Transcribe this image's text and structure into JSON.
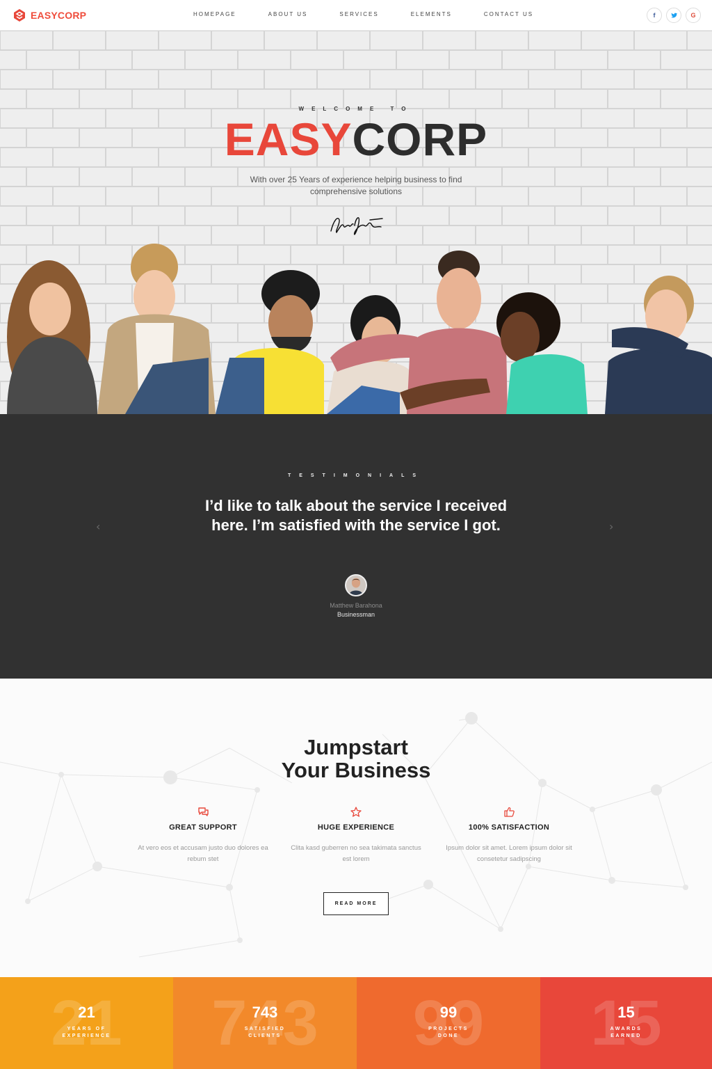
{
  "brand": {
    "name": "EASYCORP",
    "accent": "#e8473a"
  },
  "nav": {
    "items": [
      "HOMEPAGE",
      "ABOUT US",
      "SERVICES",
      "ELEMENTS",
      "CONTACT US"
    ],
    "social": [
      {
        "icon": "facebook-icon",
        "glyph": "f",
        "color": "#3b5998"
      },
      {
        "icon": "twitter-icon",
        "glyph": "t",
        "color": "#1da1f2"
      },
      {
        "icon": "google-icon",
        "glyph": "G",
        "color": "#dd4b39"
      }
    ]
  },
  "hero": {
    "welcome": "WELCOME TO",
    "title_part1": "EASY",
    "title_part2": "CORP",
    "subtitle": "With over 25 Years of experience helping business to find comprehensive solutions"
  },
  "testimonials": {
    "label": "TESTIMONIALS",
    "quote": "I’d like to talk about the service I received here. I’m satisfied with the service I got.",
    "name": "Matthew Barahona",
    "role": "Businessman",
    "prev_icon": "chevron-left-icon",
    "next_icon": "chevron-right-icon"
  },
  "jumpstart": {
    "title_line1": "Jumpstart",
    "title_line2": "Your Business",
    "features": [
      {
        "icon": "chat-bubbles-icon",
        "title": "GREAT SUPPORT",
        "text": "At vero eos et accusam justo duo dolores ea rebum stet"
      },
      {
        "icon": "star-icon",
        "title": "HUGE EXPERIENCE",
        "text": "Clita kasd guberren no sea takimata sanctus est lorem"
      },
      {
        "icon": "thumbs-up-icon",
        "title": "100% SATISFACTION",
        "text": "Ipsum dolor sit amet. Lorem ipsum dolor sit consetetur sadipscing"
      }
    ],
    "button": "READ MORE"
  },
  "stats": [
    {
      "value": "21",
      "label": "YEARS OF EXPERIENCE",
      "color": "#f4a11a"
    },
    {
      "value": "743",
      "label": "SATISFIED CLIENTS",
      "color": "#f2892a"
    },
    {
      "value": "99",
      "label": "PROJECTS DONE",
      "color": "#ef6a2e"
    },
    {
      "value": "15",
      "label": "AWARDS EARNED",
      "color": "#e8473a"
    }
  ]
}
